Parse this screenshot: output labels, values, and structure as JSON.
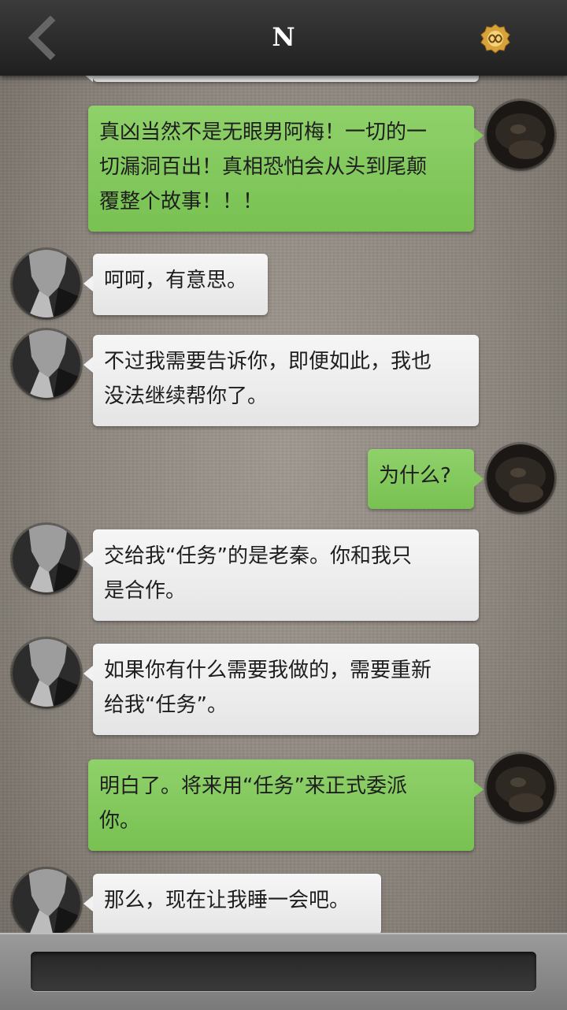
{
  "header": {
    "title": "N",
    "back_icon": "chevron-left-icon",
    "badge_icon": "infinity-badge-icon",
    "badge_color": "#d8a23a"
  },
  "colors": {
    "incoming_bubble": "#efefef",
    "outgoing_bubble": "#82c75c",
    "header_bg": "#2a2a2a"
  },
  "messages": [
    {
      "side": "right",
      "lines": [
        "真凶当然不是无眼男阿梅！一切的一",
        "切漏洞百出！真相恐怕会从头到尾颠",
        "覆整个故事！！！"
      ]
    },
    {
      "side": "left",
      "lines": [
        "呵呵，有意思。"
      ]
    },
    {
      "side": "left",
      "lines": [
        "不过我需要告诉你，即便如此，我也",
        "没法继续帮你了。"
      ]
    },
    {
      "side": "right",
      "lines": [
        "为什么?"
      ]
    },
    {
      "side": "left",
      "lines": [
        "交给我“任务”的是老秦。你和我只",
        "是合作。"
      ]
    },
    {
      "side": "left",
      "lines": [
        "如果你有什么需要我做的，需要重新",
        "给我“任务”。"
      ]
    },
    {
      "side": "right",
      "lines": [
        "明白了。将来用“任务”来正式委派",
        "你。"
      ]
    },
    {
      "side": "left",
      "lines": [
        "那么，现在让我睡一会吧。"
      ]
    }
  ],
  "composer": {
    "placeholder": ""
  }
}
